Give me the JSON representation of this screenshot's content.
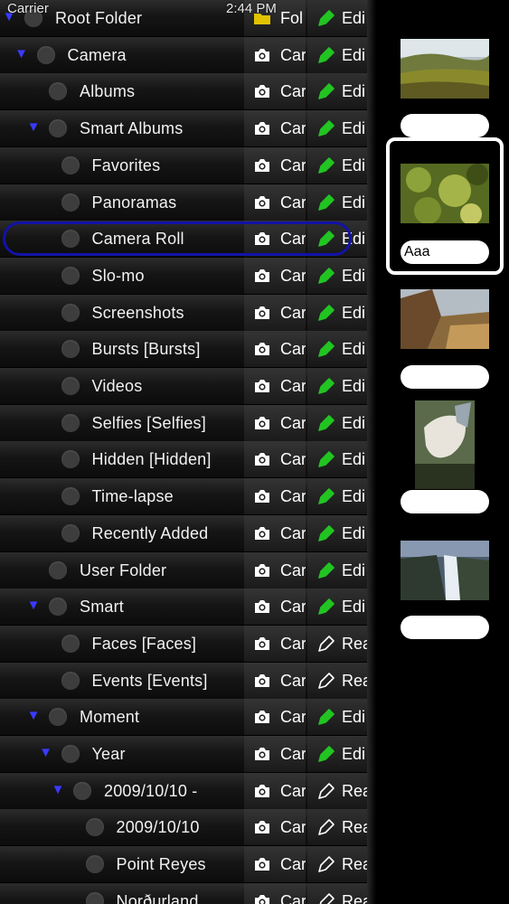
{
  "status_bar": {
    "carrier": "Carrier",
    "time": "2:44 PM"
  },
  "rows": [
    {
      "label": "Root Folder",
      "indent": 0,
      "expanded": true,
      "type": "folder",
      "type_label": "Fol",
      "action": "edit",
      "action_label": "Edi",
      "selected": false
    },
    {
      "label": "Camera",
      "indent": 1,
      "expanded": true,
      "type": "camera",
      "type_label": "Car",
      "action": "edit",
      "action_label": "Edi",
      "selected": false
    },
    {
      "label": "Albums",
      "indent": 2,
      "expanded": false,
      "type": "camera",
      "type_label": "Car",
      "action": "edit",
      "action_label": "Edi",
      "selected": false
    },
    {
      "label": "Smart Albums",
      "indent": 2,
      "expanded": true,
      "type": "camera",
      "type_label": "Car",
      "action": "edit",
      "action_label": "Edi",
      "selected": false
    },
    {
      "label": "Favorites",
      "indent": 3,
      "expanded": false,
      "type": "camera",
      "type_label": "Car",
      "action": "edit",
      "action_label": "Edi",
      "selected": false
    },
    {
      "label": "Panoramas",
      "indent": 3,
      "expanded": false,
      "type": "camera",
      "type_label": "Car",
      "action": "edit",
      "action_label": "Edi",
      "selected": false
    },
    {
      "label": "Camera Roll",
      "indent": 3,
      "expanded": false,
      "type": "camera",
      "type_label": "Car",
      "action": "edit",
      "action_label": "Edi",
      "selected": true
    },
    {
      "label": "Slo-mo",
      "indent": 3,
      "expanded": false,
      "type": "camera",
      "type_label": "Car",
      "action": "edit",
      "action_label": "Edi",
      "selected": false
    },
    {
      "label": "Screenshots",
      "indent": 3,
      "expanded": false,
      "type": "camera",
      "type_label": "Car",
      "action": "edit",
      "action_label": "Edi",
      "selected": false
    },
    {
      "label": "Bursts  [Bursts]",
      "indent": 3,
      "expanded": false,
      "type": "camera",
      "type_label": "Car",
      "action": "edit",
      "action_label": "Edi",
      "selected": false
    },
    {
      "label": "Videos",
      "indent": 3,
      "expanded": false,
      "type": "camera",
      "type_label": "Car",
      "action": "edit",
      "action_label": "Edi",
      "selected": false
    },
    {
      "label": "Selfies  [Selfies]",
      "indent": 3,
      "expanded": false,
      "type": "camera",
      "type_label": "Car",
      "action": "edit",
      "action_label": "Edi",
      "selected": false
    },
    {
      "label": "Hidden  [Hidden]",
      "indent": 3,
      "expanded": false,
      "type": "camera",
      "type_label": "Car",
      "action": "edit",
      "action_label": "Edi",
      "selected": false
    },
    {
      "label": "Time-lapse",
      "indent": 3,
      "expanded": false,
      "type": "camera",
      "type_label": "Car",
      "action": "edit",
      "action_label": "Edi",
      "selected": false
    },
    {
      "label": "Recently Added",
      "indent": 3,
      "expanded": false,
      "type": "camera",
      "type_label": "Car",
      "action": "edit",
      "action_label": "Edi",
      "selected": false
    },
    {
      "label": "User Folder",
      "indent": 2,
      "expanded": false,
      "type": "camera",
      "type_label": "Car",
      "action": "edit",
      "action_label": "Edi",
      "selected": false
    },
    {
      "label": "Smart",
      "indent": 2,
      "expanded": true,
      "type": "camera",
      "type_label": "Car",
      "action": "edit",
      "action_label": "Edi",
      "selected": false
    },
    {
      "label": "Faces  [Faces]",
      "indent": 3,
      "expanded": false,
      "type": "camera",
      "type_label": "Car",
      "action": "read",
      "action_label": "Rea",
      "selected": false
    },
    {
      "label": "Events  [Events]",
      "indent": 3,
      "expanded": false,
      "type": "camera",
      "type_label": "Car",
      "action": "read",
      "action_label": "Rea",
      "selected": false
    },
    {
      "label": "Moment",
      "indent": 2,
      "expanded": true,
      "type": "camera",
      "type_label": "Car",
      "action": "edit",
      "action_label": "Edi",
      "selected": false
    },
    {
      "label": "Year",
      "indent": 3,
      "expanded": true,
      "type": "camera",
      "type_label": "Car",
      "action": "edit",
      "action_label": "Edi",
      "selected": false
    },
    {
      "label": "2009/10/10 -",
      "indent": 4,
      "expanded": true,
      "type": "camera",
      "type_label": "Car",
      "action": "read",
      "action_label": "Rea",
      "selected": false
    },
    {
      "label": "2009/10/10",
      "indent": 5,
      "expanded": false,
      "type": "camera",
      "type_label": "Car",
      "action": "read",
      "action_label": "Rea",
      "selected": false
    },
    {
      "label": "Point Reyes",
      "indent": 5,
      "expanded": false,
      "type": "camera",
      "type_label": "Car",
      "action": "read",
      "action_label": "Rea",
      "selected": false
    },
    {
      "label": "Norðurland",
      "indent": 5,
      "expanded": false,
      "type": "camera",
      "type_label": "Car",
      "action": "read",
      "action_label": "Rea",
      "selected": false
    }
  ],
  "thumbnails": [
    {
      "caption": "",
      "selected": false,
      "scene": "meadow"
    },
    {
      "caption": "Aaa",
      "selected": true,
      "scene": "foliage"
    },
    {
      "caption": "",
      "selected": false,
      "scene": "canyon"
    },
    {
      "caption": "",
      "selected": false,
      "scene": "hand"
    },
    {
      "caption": "",
      "selected": false,
      "scene": "waterfall"
    }
  ],
  "colors": {
    "edit_icon": "#22c422",
    "folder_icon": "#e0c200",
    "disclosure": "#3a3aff",
    "selection_ring": "#1212a8"
  }
}
